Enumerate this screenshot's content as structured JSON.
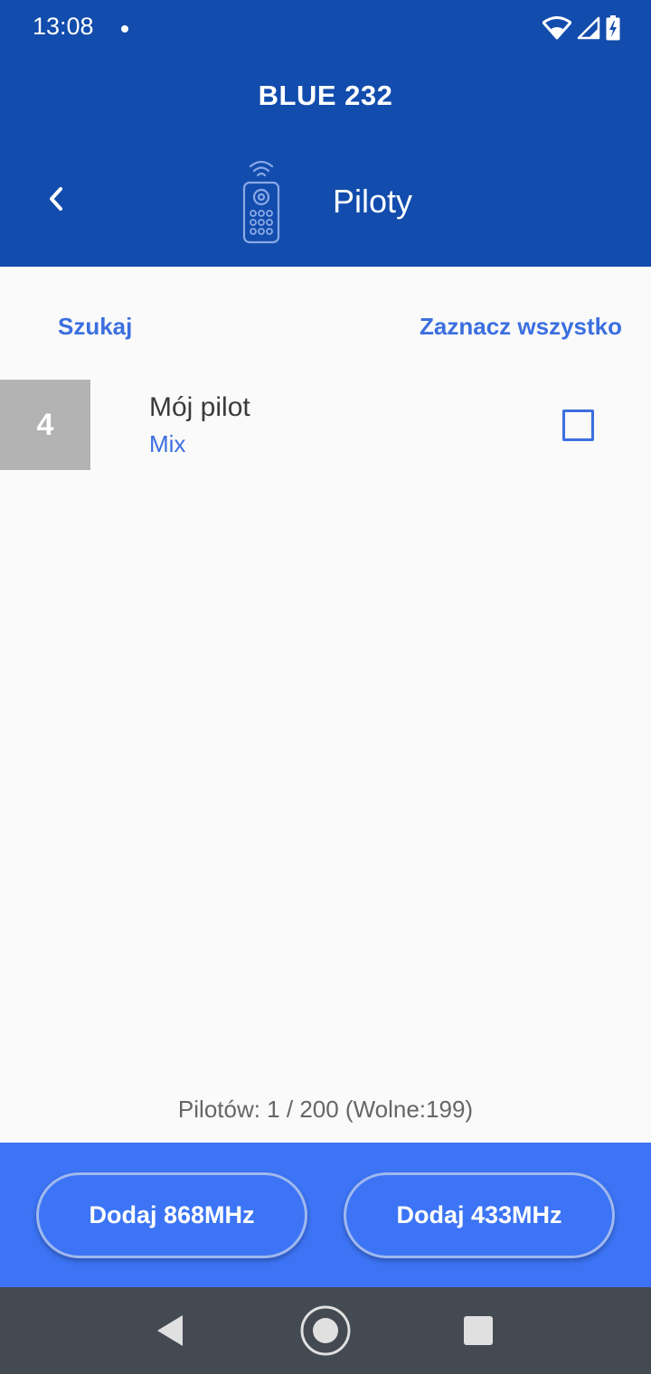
{
  "status_bar": {
    "time": "13:08",
    "icons": [
      "notification-dot-icon",
      "wifi-icon",
      "cellular-signal-icon",
      "battery-charging-icon"
    ]
  },
  "header": {
    "app_title": "BLUE 232",
    "screen_title": "Piloty",
    "back_icon": "chevron-left-icon",
    "screen_icon": "remote-control-icon"
  },
  "toolbar": {
    "search_label": "Szukaj",
    "select_all_label": "Zaznacz wszystko"
  },
  "remotes": [
    {
      "number": "4",
      "name": "Mój pilot",
      "type": "Mix",
      "checked": false
    }
  ],
  "footer": {
    "counter": "Pilotów: 1 / 200 (Wolne:199)",
    "add_868_label": "Dodaj 868MHz",
    "add_433_label": "Dodaj 433MHz"
  },
  "nav": {
    "icons": [
      "nav-back-icon",
      "nav-home-icon",
      "nav-recents-icon"
    ]
  },
  "colors": {
    "header_bg": "#124cad",
    "accent": "#3b6fe0",
    "bottom_bar_bg": "#3c74f5",
    "badge_bg": "#b3b3b3",
    "navbar_bg": "#444a52"
  }
}
